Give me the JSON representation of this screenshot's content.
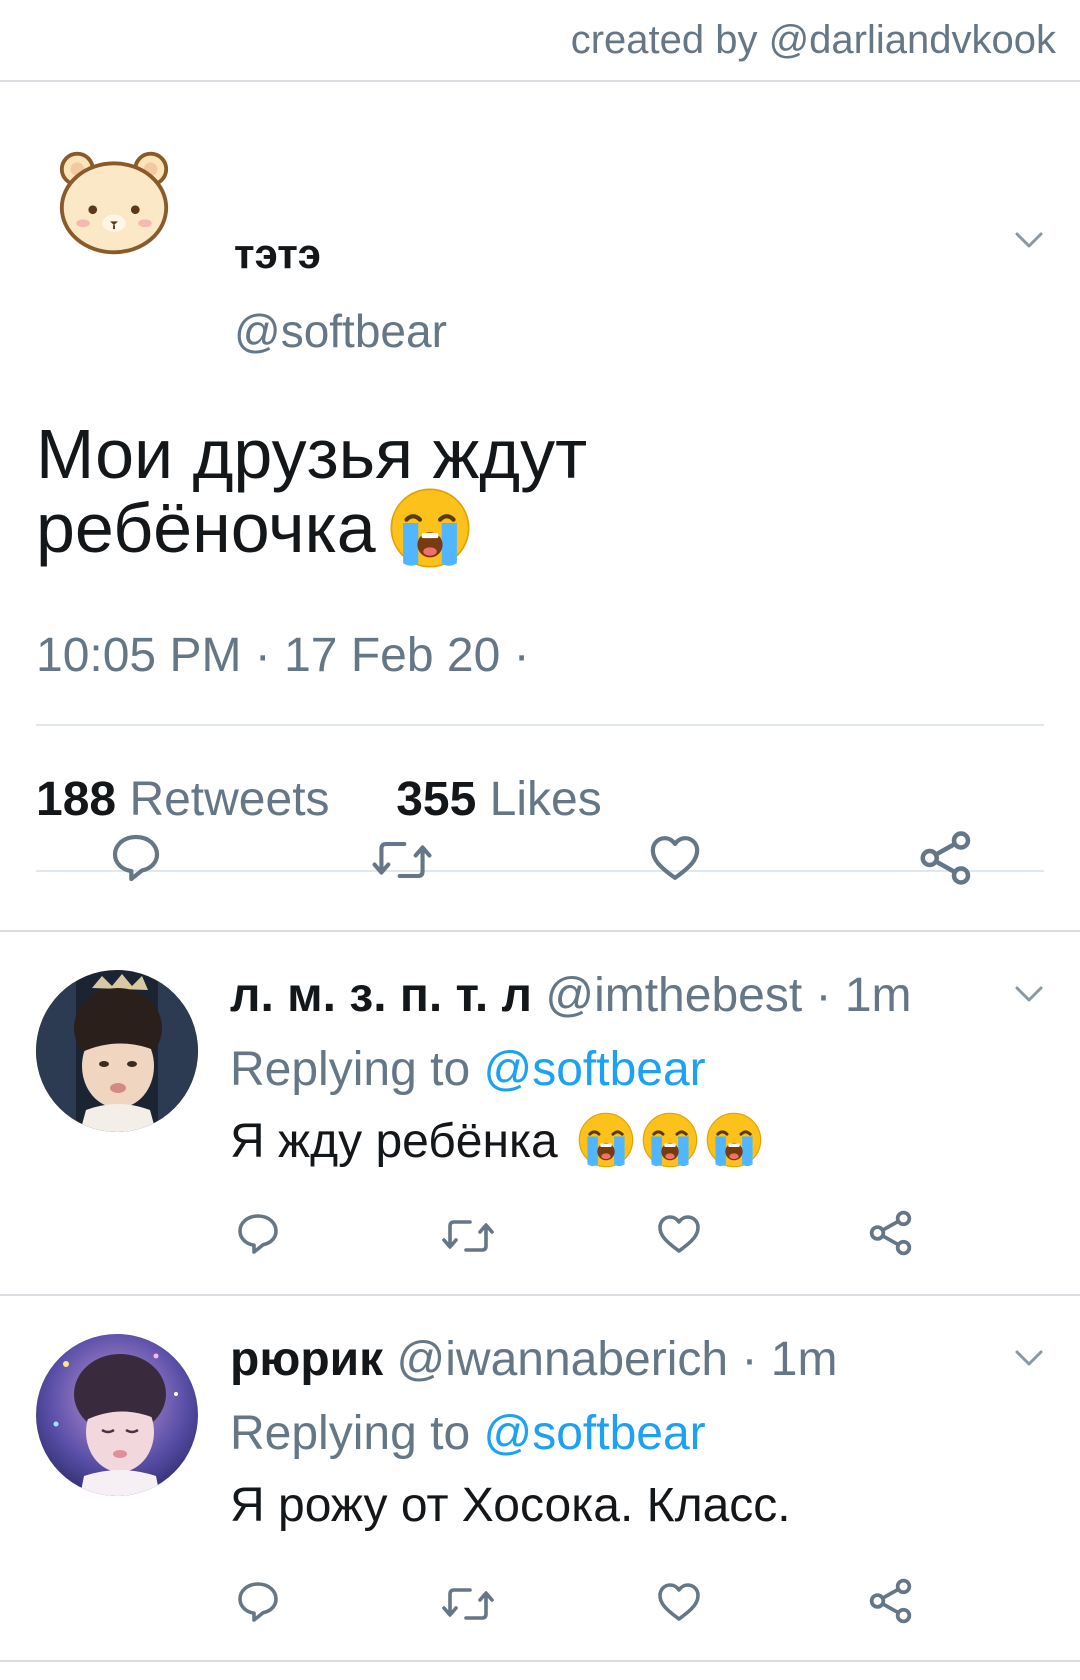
{
  "credit": "created by @darliandvkook",
  "tweet": {
    "author_name": "тэтэ",
    "author_handle": "@softbear",
    "avatar_icon": "bear-face-avatar",
    "text_line1": "Мои друзья ждут",
    "text_line2": "ребёночка",
    "text_emoji": "loudly-crying-face-icon",
    "timestamp": "10:05 PM · 17 Feb 20 ·",
    "retweets_count": "188",
    "retweets_label": "Retweets",
    "likes_count": "355",
    "likes_label": "Likes"
  },
  "replies": [
    {
      "name": "л. м. з. п. т. л",
      "handle": "@imthebest",
      "time": "· 1m",
      "replying_prefix": "Replying to",
      "replying_to": "@softbear",
      "text": "Я жду ребёнка",
      "emoji_count": 3
    },
    {
      "name": "рюрик",
      "handle": "@iwannaberich",
      "time": "· 1m",
      "replying_prefix": "Replying to",
      "replying_to": "@softbear",
      "text": "Я рожу от Хосока. Класс."
    }
  ],
  "colors": {
    "muted": "#657786",
    "link": "#1da1f2",
    "divider": "#e1e8ed",
    "icon": "#657786"
  },
  "icons": [
    "reply-icon",
    "retweet-icon",
    "like-icon",
    "share-icon",
    "chevron-down-icon"
  ]
}
